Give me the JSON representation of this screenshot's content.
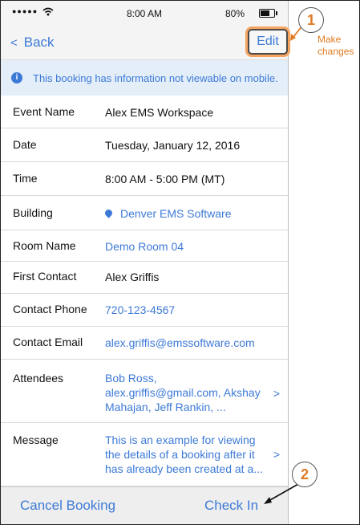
{
  "status_bar": {
    "carrier": "●●●●●",
    "time": "8:00 AM",
    "battery": "80%"
  },
  "nav": {
    "back_label": "Back",
    "edit_label": "Edit"
  },
  "info_banner": {
    "icon": "info-icon",
    "text": "This booking has information not viewable on mobile."
  },
  "details": {
    "event_name": {
      "label": "Event Name",
      "value": "Alex EMS Workspace"
    },
    "date": {
      "label": "Date",
      "value": "Tuesday, January 12, 2016"
    },
    "time": {
      "label": "Time",
      "value": "8:00 AM - 5:00 PM (MT)"
    },
    "building": {
      "label": "Building",
      "value": "Denver EMS Software"
    },
    "room_name": {
      "label": "Room Name",
      "value": "Demo Room 04"
    },
    "first_contact": {
      "label": "First Contact",
      "value": "Alex Griffis"
    },
    "contact_phone": {
      "label": "Contact Phone",
      "value": "720-123-4567"
    },
    "contact_email": {
      "label": "Contact Email",
      "value": "alex.griffis@emssoftware.com"
    },
    "attendees": {
      "label": "Attendees",
      "value": "Bob Ross, alex.griffis@gmail.com, Akshay Mahajan, Jeff Rankin, ..."
    },
    "message": {
      "label": "Message",
      "value": "This is an example for viewing the details of a booking after it has already been created at a..."
    }
  },
  "toolbar": {
    "cancel_label": "Cancel Booking",
    "checkin_label": "Check In"
  },
  "annotations": {
    "callout_1": "1",
    "callout_1_note": "Make changes",
    "callout_2": "2"
  },
  "colors": {
    "accent": "#3d7ad6",
    "annotation": "#e07b24",
    "info_bg": "#e4eef9"
  }
}
